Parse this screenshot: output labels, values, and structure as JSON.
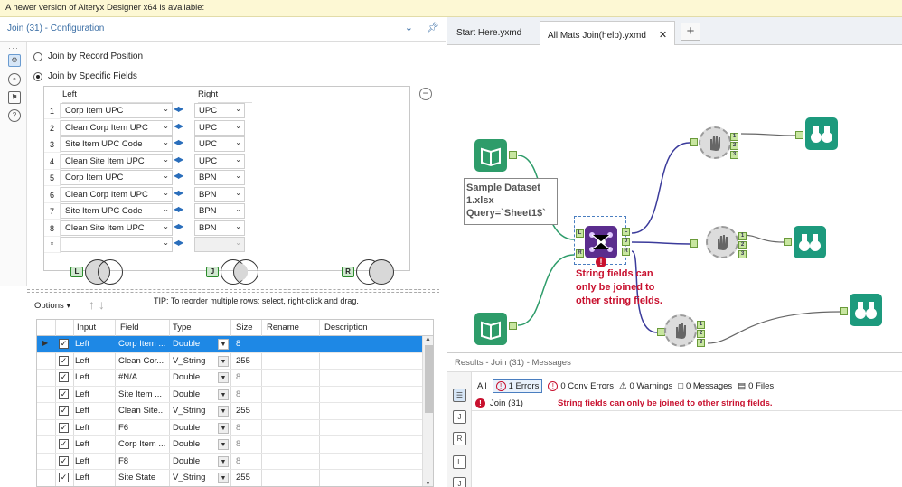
{
  "update_notice": "A newer version of Alteryx Designer x64 is available:",
  "config": {
    "title": "Join (31) - Configuration",
    "radio_record_position": "Join by Record Position",
    "radio_specific_fields": "Join by Specific Fields",
    "col_left": "Left",
    "col_right": "Right",
    "join_rows": [
      {
        "n": "1",
        "left": "Corp Item UPC",
        "right": "UPC"
      },
      {
        "n": "2",
        "left": "Clean Corp Item UPC",
        "right": "UPC"
      },
      {
        "n": "3",
        "left": "Site Item UPC Code",
        "right": "UPC"
      },
      {
        "n": "4",
        "left": "Clean Site Item UPC",
        "right": "UPC"
      },
      {
        "n": "5",
        "left": "Corp Item UPC",
        "right": "BPN"
      },
      {
        "n": "6",
        "left": "Clean Corp Item UPC",
        "right": "BPN"
      },
      {
        "n": "7",
        "left": "Site Item UPC Code",
        "right": "BPN"
      },
      {
        "n": "8",
        "left": "Clean Site Item UPC",
        "right": "BPN"
      },
      {
        "n": "*",
        "left": "",
        "right": ""
      }
    ],
    "venn_labels": [
      "L",
      "J",
      "R"
    ],
    "options_label": "Options",
    "tip": "TIP: To reorder multiple rows: select, right-click and drag.",
    "field_headers": [
      "Input",
      "Field",
      "Type",
      "Size",
      "Rename",
      "Description"
    ],
    "field_rows": [
      {
        "input": "Left",
        "field": "Corp Item ...",
        "type": "Double",
        "size": "8"
      },
      {
        "input": "Left",
        "field": "Clean Cor...",
        "type": "V_String",
        "size": "255"
      },
      {
        "input": "Left",
        "field": "#N/A",
        "type": "Double",
        "size": "8"
      },
      {
        "input": "Left",
        "field": "Site Item ...",
        "type": "Double",
        "size": "8"
      },
      {
        "input": "Left",
        "field": "Clean Site...",
        "type": "V_String",
        "size": "255"
      },
      {
        "input": "Left",
        "field": "F6",
        "type": "Double",
        "size": "8"
      },
      {
        "input": "Left",
        "field": "Corp Item ...",
        "type": "Double",
        "size": "8"
      },
      {
        "input": "Left",
        "field": "F8",
        "type": "Double",
        "size": "8"
      },
      {
        "input": "Left",
        "field": "Site State",
        "type": "V_String",
        "size": "255"
      }
    ]
  },
  "tabs": [
    {
      "label": "Start Here.yxmd"
    },
    {
      "label": "All Mats Join(help).yxmd"
    }
  ],
  "canvas": {
    "annotation": [
      "Sample Dataset",
      "1.xlsx",
      "Query=`Sheet1$`"
    ],
    "error_note": "String fields can only be joined to other string fields.",
    "join_anchors": [
      "L",
      "R",
      "J",
      "L",
      "R"
    ],
    "filter_anchors": [
      "1",
      "2",
      "3"
    ]
  },
  "results": {
    "header": "Results - Join (31) - Messages",
    "all": "All",
    "errors": "1 Errors",
    "conv_errors": "0 Conv Errors",
    "warnings": "0 Warnings",
    "messages": "0 Messages",
    "files": "0 Files",
    "row_tool": "Join (31)",
    "row_message": "String fields can only be joined to other string fields."
  },
  "colors": {
    "error": "#c8102e",
    "selection": "#1e88e5",
    "input_tool": "#2e9c6a",
    "join_tool": "#5b2d8e",
    "browse_tool": "#1d9a7d"
  }
}
